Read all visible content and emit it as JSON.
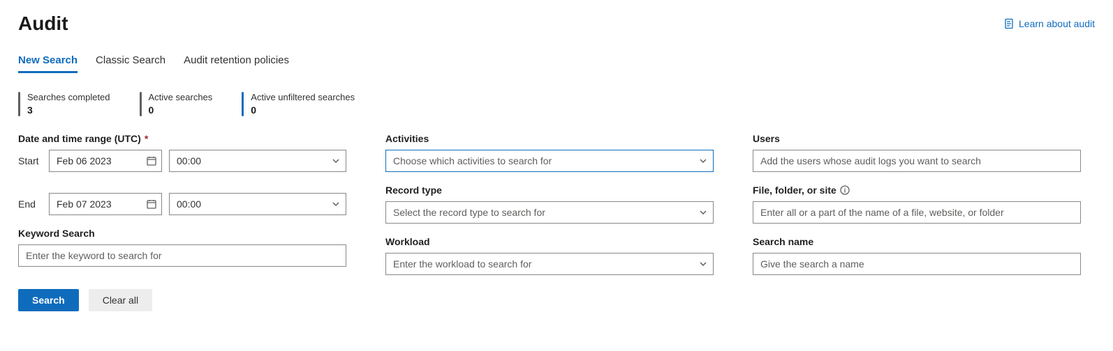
{
  "header": {
    "title": "Audit",
    "learn_link": "Learn about audit"
  },
  "tabs": [
    {
      "label": "New Search",
      "active": true
    },
    {
      "label": "Classic Search",
      "active": false
    },
    {
      "label": "Audit retention policies",
      "active": false
    }
  ],
  "stats": {
    "completed": {
      "label": "Searches completed",
      "value": "3"
    },
    "active": {
      "label": "Active searches",
      "value": "0"
    },
    "unfiltered": {
      "label": "Active unfiltered searches",
      "value": "0"
    }
  },
  "form": {
    "datetime_range_label": "Date and time range (UTC)",
    "start_label": "Start",
    "start_date": "Feb 06 2023",
    "start_time": "00:00",
    "end_label": "End",
    "end_date": "Feb 07 2023",
    "end_time": "00:00",
    "keyword_label": "Keyword Search",
    "keyword_placeholder": "Enter the keyword to search for",
    "activities_label": "Activities",
    "activities_placeholder": "Choose which activities to search for",
    "record_type_label": "Record type",
    "record_type_placeholder": "Select the record type to search for",
    "workload_label": "Workload",
    "workload_placeholder": "Enter the workload to search for",
    "users_label": "Users",
    "users_placeholder": "Add the users whose audit logs you want to search",
    "file_label": "File, folder, or site",
    "file_placeholder": "Enter all or a part of the name of a file, website, or folder",
    "searchname_label": "Search name",
    "searchname_placeholder": "Give the search a name"
  },
  "actions": {
    "search": "Search",
    "clear": "Clear all"
  }
}
